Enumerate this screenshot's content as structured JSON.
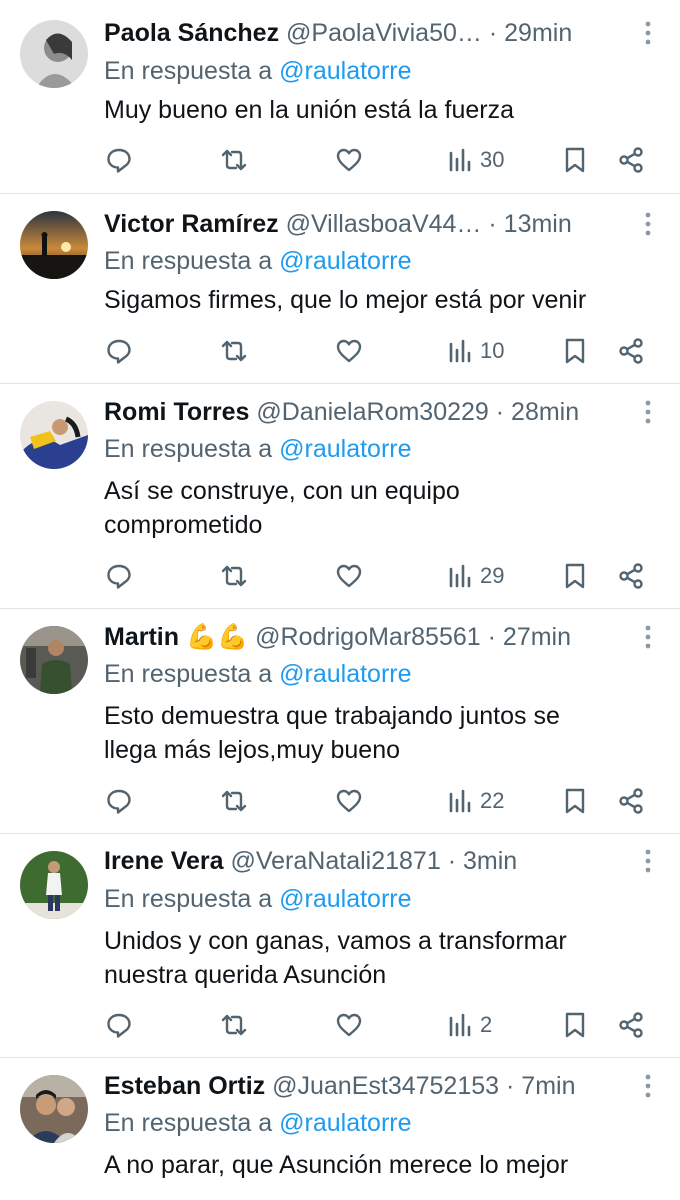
{
  "reply_prefix": "En respuesta a",
  "tweets": [
    {
      "name": "Paola Sánchez",
      "emoji": "",
      "handle": "@PaolaVivia50…",
      "time": "· 29min",
      "reply_to": "@raulatorre",
      "lines": [
        "Muy bueno en la unión está la fuerza"
      ],
      "views": "30"
    },
    {
      "name": "Victor Ramírez",
      "emoji": "",
      "handle": "@VillasboaV44…",
      "time": "· 13min",
      "reply_to": "@raulatorre",
      "lines": [
        "Sigamos firmes, que lo mejor está por venir"
      ],
      "views": "10"
    },
    {
      "name": "Romi Torres",
      "emoji": "",
      "handle": "@DanielaRom30229",
      "time": "· 28min",
      "reply_to": "@raulatorre",
      "lines": [
        "Así se construye, con un equipo",
        "comprometido"
      ],
      "views": "29"
    },
    {
      "name": "Martin",
      "emoji": "💪💪",
      "handle": "@RodrigoMar85561",
      "time": "· 27min",
      "reply_to": "@raulatorre",
      "lines": [
        "Esto demuestra que trabajando juntos se",
        "llega más lejos,muy bueno"
      ],
      "views": "22"
    },
    {
      "name": "Irene Vera",
      "emoji": "",
      "handle": "@VeraNatali21871",
      "time": "· 3min",
      "reply_to": "@raulatorre",
      "lines": [
        "Unidos y con ganas, vamos a transformar",
        "nuestra querida Asunción"
      ],
      "views": "2"
    },
    {
      "name": "Esteban Ortiz",
      "emoji": "",
      "handle": "@JuanEst34752153",
      "time": "· 7min",
      "reply_to": "@raulatorre",
      "lines": [
        "A no parar, que Asunción merece lo mejor"
      ],
      "views": ""
    }
  ],
  "icons": {
    "reply": "reply-bubble-icon",
    "retweet": "retweet-icon",
    "like": "heart-icon",
    "views": "views-bar-chart-icon",
    "bookmark": "bookmark-icon",
    "share": "share-icon",
    "more": "more-vertical-icon"
  },
  "colors": {
    "mention": "#1d9bf0",
    "secondary_text": "#536471",
    "primary_text": "#0f1419",
    "divider": "#e1e4e7"
  }
}
